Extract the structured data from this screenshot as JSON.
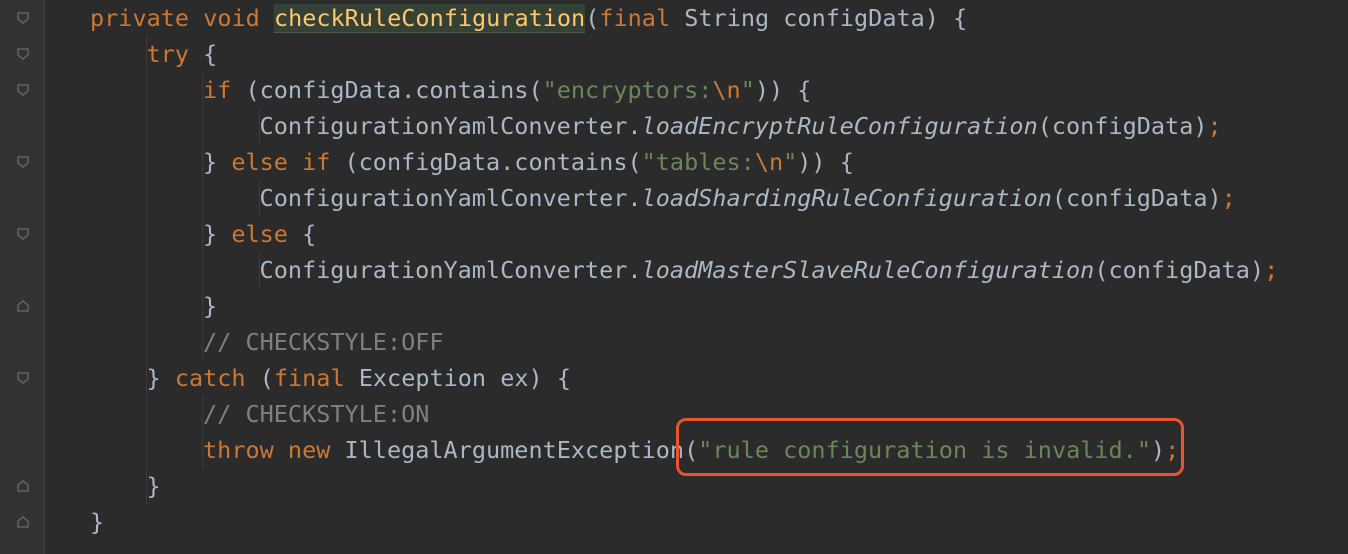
{
  "editor": {
    "language": "Java",
    "highlight_color": "#e8542d",
    "lines": [
      {
        "tokens": [
          {
            "t": "kw",
            "v": "private "
          },
          {
            "t": "kw",
            "v": "void "
          },
          {
            "t": "method-decl",
            "v": "checkRuleConfiguration"
          },
          {
            "t": "punct",
            "v": "("
          },
          {
            "t": "kw",
            "v": "final "
          },
          {
            "t": "ident",
            "v": "String configData) {"
          }
        ]
      },
      {
        "tokens": [
          {
            "t": "kw",
            "v": "try "
          },
          {
            "t": "punct",
            "v": "{"
          }
        ]
      },
      {
        "tokens": [
          {
            "t": "kw",
            "v": "if "
          },
          {
            "t": "ident",
            "v": "(configData.contains("
          },
          {
            "t": "str",
            "v": "\"encryptors:"
          },
          {
            "t": "esc",
            "v": "\\n"
          },
          {
            "t": "str",
            "v": "\""
          },
          {
            "t": "ident",
            "v": ")) {"
          }
        ]
      },
      {
        "tokens": [
          {
            "t": "ident",
            "v": "ConfigurationYamlConverter."
          },
          {
            "t": "static-call",
            "v": "loadEncryptRuleConfiguration"
          },
          {
            "t": "ident",
            "v": "(configData)"
          },
          {
            "t": "semi",
            "v": ";"
          }
        ]
      },
      {
        "tokens": [
          {
            "t": "ident",
            "v": "} "
          },
          {
            "t": "kw",
            "v": "else if "
          },
          {
            "t": "ident",
            "v": "(configData.contains("
          },
          {
            "t": "str",
            "v": "\"tables:"
          },
          {
            "t": "esc",
            "v": "\\n"
          },
          {
            "t": "str",
            "v": "\""
          },
          {
            "t": "ident",
            "v": ")) {"
          }
        ]
      },
      {
        "tokens": [
          {
            "t": "ident",
            "v": "ConfigurationYamlConverter."
          },
          {
            "t": "static-call",
            "v": "loadShardingRuleConfiguration"
          },
          {
            "t": "ident",
            "v": "(configData)"
          },
          {
            "t": "semi",
            "v": ";"
          }
        ]
      },
      {
        "tokens": [
          {
            "t": "ident",
            "v": "} "
          },
          {
            "t": "kw",
            "v": "else "
          },
          {
            "t": "ident",
            "v": "{"
          }
        ]
      },
      {
        "tokens": [
          {
            "t": "ident",
            "v": "ConfigurationYamlConverter."
          },
          {
            "t": "static-call",
            "v": "loadMasterSlaveRuleConfiguration"
          },
          {
            "t": "ident",
            "v": "(configData)"
          },
          {
            "t": "semi",
            "v": ";"
          }
        ]
      },
      {
        "tokens": [
          {
            "t": "ident",
            "v": "}"
          }
        ]
      },
      {
        "tokens": [
          {
            "t": "cmt",
            "v": "// CHECKSTYLE:OFF"
          }
        ]
      },
      {
        "tokens": [
          {
            "t": "ident",
            "v": "} "
          },
          {
            "t": "kw",
            "v": "catch "
          },
          {
            "t": "ident",
            "v": "("
          },
          {
            "t": "kw",
            "v": "final "
          },
          {
            "t": "ident",
            "v": "Exception ex) {"
          }
        ]
      },
      {
        "tokens": [
          {
            "t": "cmt",
            "v": "// CHECKSTYLE:ON"
          }
        ]
      },
      {
        "tokens": [
          {
            "t": "kw",
            "v": "throw new "
          },
          {
            "t": "ident",
            "v": "IllegalArgumentException("
          },
          {
            "t": "str",
            "v": "\"rule configuration is invalid.\""
          },
          {
            "t": "ident",
            "v": ")"
          },
          {
            "t": "semi",
            "v": ";"
          }
        ]
      },
      {
        "tokens": [
          {
            "t": "ident",
            "v": "}"
          }
        ]
      },
      {
        "tokens": [
          {
            "t": "ident",
            "v": "}"
          }
        ]
      }
    ]
  }
}
